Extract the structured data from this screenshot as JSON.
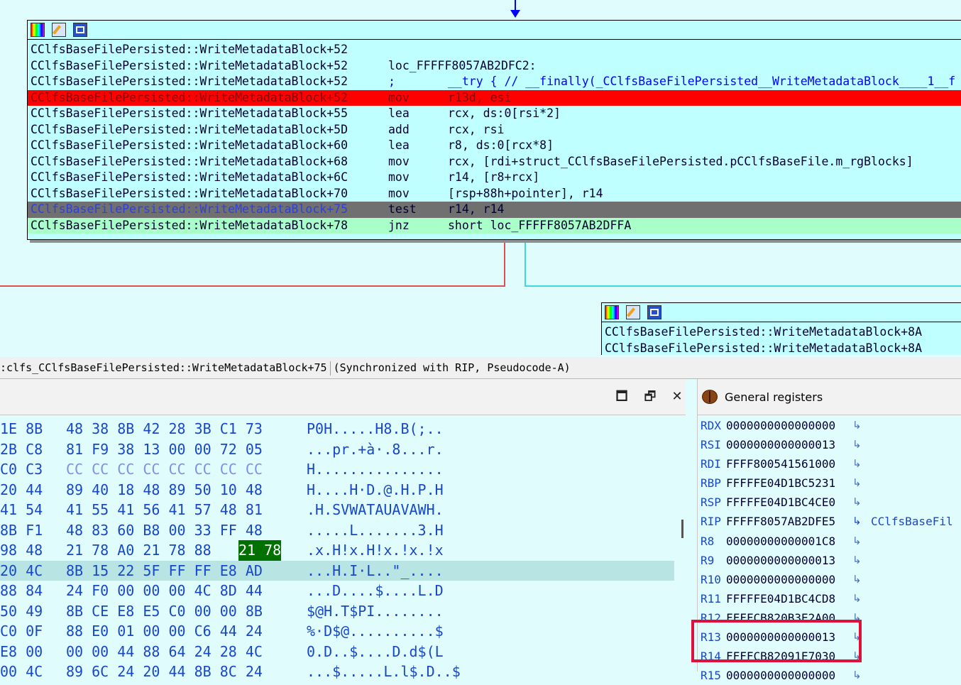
{
  "upper_node": {
    "lines": [
      {
        "addr": "CClfsBaseFilePersisted::WriteMetadataBlock+52",
        "mnemonic": "",
        "operands": ""
      },
      {
        "addr": "CClfsBaseFilePersisted::WriteMetadataBlock+52",
        "mnemonic": "loc_FFFFF8057AB2DFC2:",
        "operands": ""
      },
      {
        "addr": "CClfsBaseFilePersisted::WriteMetadataBlock+52",
        "mnemonic": ";",
        "operands": "__try { // __finally(_CClfsBaseFilePersisted__WriteMetadataBlock____1__f"
      },
      {
        "addr": "CClfsBaseFilePersisted::WriteMetadataBlock+52",
        "mnemonic": "mov",
        "operands": "r13d, esi"
      },
      {
        "addr": "CClfsBaseFilePersisted::WriteMetadataBlock+55",
        "mnemonic": "lea",
        "operands": "rcx, ds:0[rsi*2]"
      },
      {
        "addr": "CClfsBaseFilePersisted::WriteMetadataBlock+5D",
        "mnemonic": "add",
        "operands": "rcx, rsi"
      },
      {
        "addr": "CClfsBaseFilePersisted::WriteMetadataBlock+60",
        "mnemonic": "lea",
        "operands": "r8, ds:0[rcx*8]"
      },
      {
        "addr": "CClfsBaseFilePersisted::WriteMetadataBlock+68",
        "mnemonic": "mov",
        "operands": "rcx, [rdi+struct_CClfsBaseFilePersisted.pCClfsBaseFile.m_rgBlocks]"
      },
      {
        "addr": "CClfsBaseFilePersisted::WriteMetadataBlock+6C",
        "mnemonic": "mov",
        "operands": "r14, [r8+rcx]"
      },
      {
        "addr": "CClfsBaseFilePersisted::WriteMetadataBlock+70",
        "mnemonic": "mov",
        "operands": "[rsp+88h+pointer], r14"
      },
      {
        "addr": "CClfsBaseFilePersisted::WriteMetadataBlock+75",
        "mnemonic": "test",
        "operands": "r14, r14"
      },
      {
        "addr": "CClfsBaseFilePersisted::WriteMetadataBlock+78",
        "mnemonic": "jnz",
        "operands": "short loc_FFFFF8057AB2DFFA"
      }
    ]
  },
  "lower_node": {
    "lines": [
      {
        "addr": "CClfsBaseFilePersisted::WriteMetadataBlock+8A"
      },
      {
        "addr": "CClfsBaseFilePersisted::WriteMetadataBlock+8A"
      }
    ]
  },
  "sync_bar": {
    "location": ":clfs_CClfsBaseFilePersisted::WriteMetadataBlock+75",
    "status": "(Synchronized with RIP, Pseudocode-A)"
  },
  "hex_view": {
    "window_buttons": {
      "maximize": "🗖",
      "restore": "🗗",
      "close": "✕"
    },
    "rows": [
      {
        "b1": "1E 8B",
        "b2": "48 38 8B 42 28 3B C1 73",
        "ascii": "P0H.....H8.B(;.."
      },
      {
        "b1": "2B C8",
        "b2": "81 F9 38 13 00 00 72 05",
        "ascii": "...pr.+à·.8...r."
      },
      {
        "b1": "C0 C3",
        "b2": "CC CC CC CC CC CC CC CC",
        "ascii": "H..............."
      },
      {
        "b1": "20 44",
        "b2": "89 40 18 48 89 50 10 48",
        "ascii": "H....H·D.@.H.P.H"
      },
      {
        "b1": "41 54",
        "b2": "41 55 41 56 41 57 48 81",
        "ascii": ".H.SVWATAUAVAWH."
      },
      {
        "b1": "8B F1",
        "b2": "48 83 60 B8 00 33 FF 48",
        "ascii": ".....L.......3.H"
      },
      {
        "b1": "98 48",
        "b2": "21 78 A0 21 78 88",
        "sel": "21 78",
        "ascii": ".x.H!x.H!x.!x.!x"
      },
      {
        "b1": "20 4C",
        "b2": "8B 15 22 5F FF FF E8 AD",
        "ascii": "...H.I·L..\"_...."
      },
      {
        "b1": "88 84",
        "b2": "24 F0 00 00 00 4C 8D 44",
        "ascii": "...D....$....L.D"
      },
      {
        "b1": "50 49",
        "b2": "8B CE E8 E5 C0 00 00 8B",
        "ascii": "$@H.T$PI........"
      },
      {
        "b1": "C0 0F",
        "b2": "88 E0 01 00 00 C6 44 24",
        "ascii": "%·D$@..........$"
      },
      {
        "b1": "E8 00",
        "b2": "00 00 44 88 64 24 28 4C",
        "ascii": "0.D..$....D.d$(L"
      },
      {
        "b1": "00 4C",
        "b2": "89 6C 24 20 44 8B 8C 24",
        "ascii": "...$.....L.l$.D..$"
      }
    ]
  },
  "registers": {
    "title": "General registers",
    "rows": [
      {
        "name": "RDX",
        "value": "0000000000000000",
        "symbol": ""
      },
      {
        "name": "RSI",
        "value": "0000000000000013",
        "symbol": ""
      },
      {
        "name": "RDI",
        "value": "FFFF800541561000",
        "symbol": ""
      },
      {
        "name": "RBP",
        "value": "FFFFFE04D1BC5231",
        "symbol": ""
      },
      {
        "name": "RSP",
        "value": "FFFFFE04D1BC4CE0",
        "symbol": ""
      },
      {
        "name": "RIP",
        "value": "FFFFF8057AB2DFE5",
        "symbol": "CClfsBaseFil"
      },
      {
        "name": "R8",
        "value": "00000000000001C8",
        "symbol": ""
      },
      {
        "name": "R9",
        "value": "0000000000000013",
        "symbol": ""
      },
      {
        "name": "R10",
        "value": "0000000000000000",
        "symbol": ""
      },
      {
        "name": "R11",
        "value": "FFFFFE04D1BC4CD8",
        "symbol": ""
      },
      {
        "name": "R12",
        "value": "FFFFCB820B3E2A00",
        "symbol": ""
      },
      {
        "name": "R13",
        "value": "0000000000000013",
        "symbol": ""
      },
      {
        "name": "R14",
        "value": "FFFFCB82091E7030",
        "symbol": ""
      },
      {
        "name": "R15",
        "value": "0000000000000000",
        "symbol": ""
      }
    ]
  },
  "colors": {
    "graph_bg": "#e0fcfc",
    "node_bg": "#c0ffff",
    "breakpoint": "#ff0000",
    "current_line": "#707070",
    "next_line": "#a8ffc8",
    "highlight_box": "#e0103c",
    "hex_selection": "#007000"
  },
  "icons": [
    "color-palette-icon",
    "edit-node-icon",
    "graph-view-icon",
    "maximize-icon",
    "restore-icon",
    "close-icon",
    "bug-icon",
    "jump-arrow-icon"
  ]
}
